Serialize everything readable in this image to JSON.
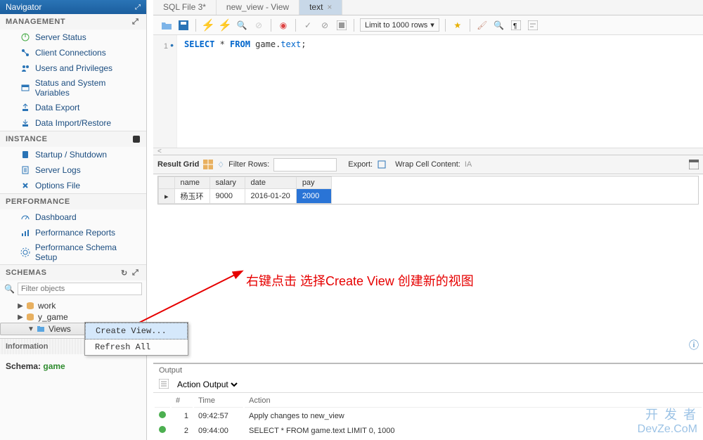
{
  "navigator": {
    "title": "Navigator",
    "management": {
      "label": "MANAGEMENT",
      "items": [
        {
          "label": "Server Status",
          "icon": "power-icon"
        },
        {
          "label": "Client Connections",
          "icon": "connections-icon"
        },
        {
          "label": "Users and Privileges",
          "icon": "users-icon"
        },
        {
          "label": "Status and System Variables",
          "icon": "status-icon"
        },
        {
          "label": "Data Export",
          "icon": "export-icon"
        },
        {
          "label": "Data Import/Restore",
          "icon": "import-icon"
        }
      ]
    },
    "instance": {
      "label": "INSTANCE",
      "items": [
        {
          "label": "Startup / Shutdown",
          "icon": "startup-icon"
        },
        {
          "label": "Server Logs",
          "icon": "logs-icon"
        },
        {
          "label": "Options File",
          "icon": "options-icon"
        }
      ]
    },
    "performance": {
      "label": "PERFORMANCE",
      "items": [
        {
          "label": "Dashboard",
          "icon": "dashboard-icon"
        },
        {
          "label": "Performance Reports",
          "icon": "reports-icon"
        },
        {
          "label": "Performance Schema Setup",
          "icon": "setup-icon"
        }
      ]
    },
    "schemas": {
      "label": "SCHEMAS",
      "filter_placeholder": "Filter objects",
      "tree": [
        {
          "label": "work",
          "icon": "db-icon",
          "expand": "▶"
        },
        {
          "label": "y_game",
          "icon": "db-icon",
          "expand": "▶"
        },
        {
          "label": "Views",
          "icon": "folder-icon",
          "expand": "▼",
          "selected": true
        }
      ]
    },
    "information": {
      "label": "Information",
      "schema_label": "Schema:",
      "schema_value": "game"
    }
  },
  "context_menu": {
    "items": [
      {
        "label": "Create View...",
        "highlight": true
      },
      {
        "label": "Refresh All",
        "highlight": false
      }
    ]
  },
  "tabs": [
    {
      "label": "SQL File 3*",
      "active": false
    },
    {
      "label": "new_view - View",
      "active": false
    },
    {
      "label": "text",
      "active": true
    }
  ],
  "toolbar": {
    "limit_label": "Limit to 1000 rows"
  },
  "editor": {
    "line_number": "1",
    "code_tokens": [
      {
        "text": "SELECT",
        "cls": "kw"
      },
      {
        "text": " * ",
        "cls": "ident"
      },
      {
        "text": "FROM",
        "cls": "kw"
      },
      {
        "text": " game.",
        "cls": "ident"
      },
      {
        "text": "text",
        "cls": "prop"
      },
      {
        "text": ";",
        "cls": "ident"
      }
    ]
  },
  "result": {
    "toolbar_label": "Result Grid",
    "filter_label": "Filter Rows:",
    "export_label": "Export:",
    "wrap_label": "Wrap Cell Content:",
    "columns": [
      "name",
      "salary",
      "date",
      "pay"
    ],
    "rows": [
      {
        "name": "杨玉环",
        "salary": "9000",
        "date": "2016-01-20",
        "pay": "2000",
        "selected_col": "pay"
      }
    ]
  },
  "output": {
    "title": "Output",
    "selector": "Action Output",
    "columns": [
      "",
      "#",
      "Time",
      "Action"
    ],
    "rows": [
      {
        "status": "ok",
        "num": "1",
        "time": "09:42:57",
        "action": "Apply changes to new_view"
      },
      {
        "status": "ok",
        "num": "2",
        "time": "09:44:00",
        "action": "SELECT * FROM game.text LIMIT 0, 1000"
      }
    ]
  },
  "annotation": {
    "text": "右键点击 选择Create View 创建新的视图"
  },
  "watermark": {
    "line1": "开 发 者",
    "line2": "DevZe.CoM"
  }
}
